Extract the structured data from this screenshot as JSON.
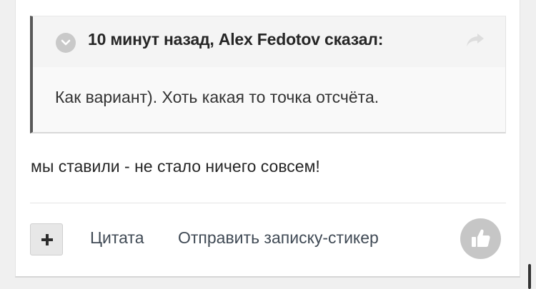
{
  "quote": {
    "citation": "10 минут назад, Alex Fedotov сказал:",
    "body": "Как вариант). Хоть какая то точка отсчёта."
  },
  "post": {
    "text": "мы ставили - не стало ничего совсем!"
  },
  "actions": {
    "quote_label": "Цитата",
    "sticker_label": "Отправить записку-стикер"
  },
  "icons": {
    "collapse": "chevron-down-icon",
    "share": "share-icon",
    "multiquote": "plus-icon",
    "reaction": "thumbs-up-icon"
  },
  "colors": {
    "quote_border": "#585858",
    "icon_gray": "#c6c6c6",
    "link_text": "#404a55"
  }
}
